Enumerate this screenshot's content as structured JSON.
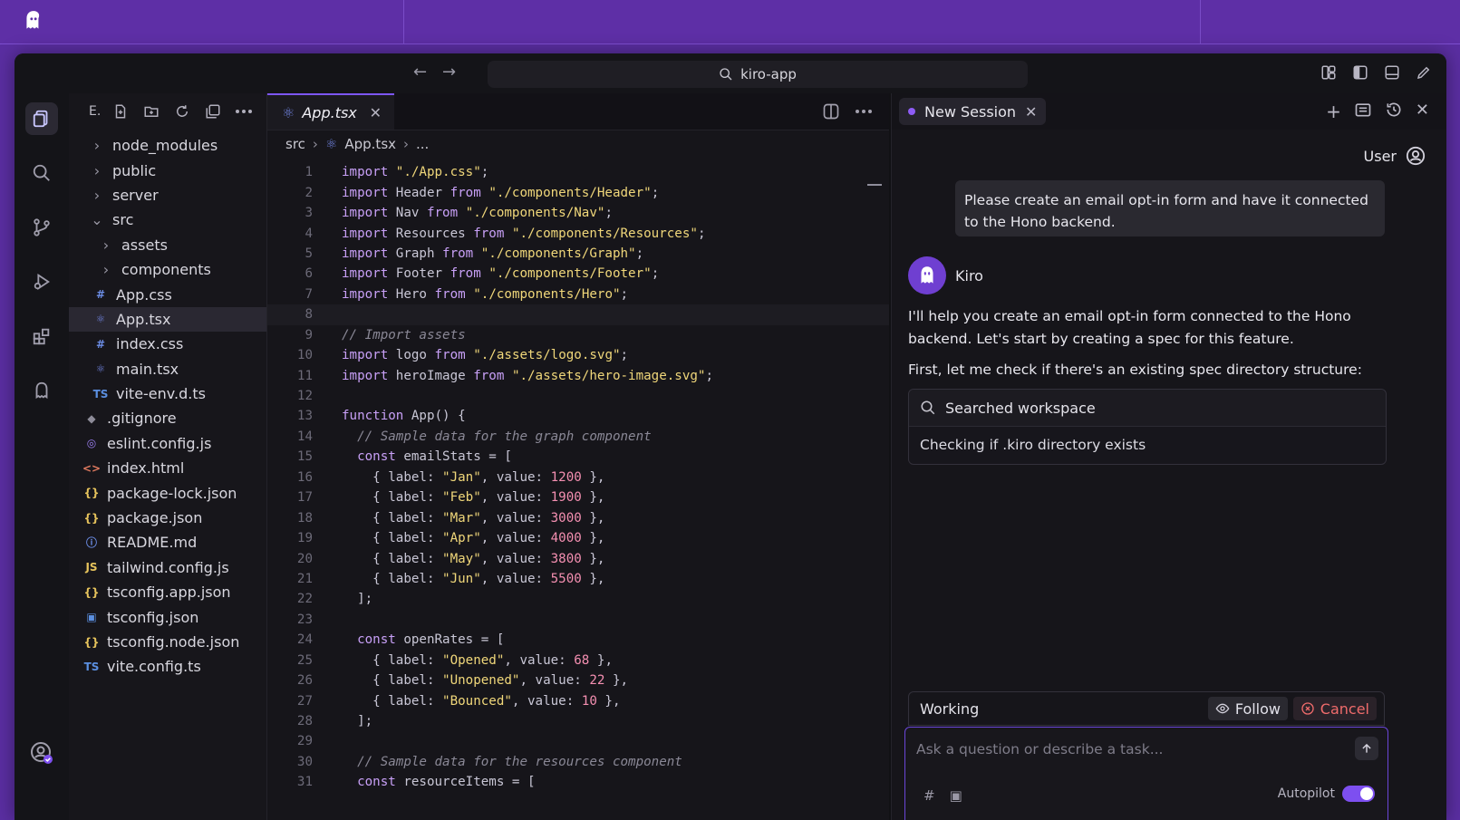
{
  "titlebar": {
    "search_text": "kiro-app"
  },
  "explorer": {
    "header_label": "E.",
    "items": [
      {
        "label": "node_modules",
        "type": "folder",
        "depth": 1,
        "expanded": false
      },
      {
        "label": "public",
        "type": "folder",
        "depth": 1,
        "expanded": false
      },
      {
        "label": "server",
        "type": "folder",
        "depth": 1,
        "expanded": false
      },
      {
        "label": "src",
        "type": "folder",
        "depth": 1,
        "expanded": true
      },
      {
        "label": "assets",
        "type": "folder",
        "depth": 2,
        "expanded": false
      },
      {
        "label": "components",
        "type": "folder",
        "depth": 2,
        "expanded": false
      },
      {
        "label": "App.css",
        "type": "css",
        "depth": 2
      },
      {
        "label": "App.tsx",
        "type": "tsx",
        "depth": 2,
        "selected": true
      },
      {
        "label": "index.css",
        "type": "css",
        "depth": 2
      },
      {
        "label": "main.tsx",
        "type": "tsx",
        "depth": 2
      },
      {
        "label": "vite-env.d.ts",
        "type": "ts",
        "depth": 2
      },
      {
        "label": ".gitignore",
        "type": "git",
        "depth": 1
      },
      {
        "label": "eslint.config.js",
        "type": "eslint",
        "depth": 1
      },
      {
        "label": "index.html",
        "type": "html",
        "depth": 1
      },
      {
        "label": "package-lock.json",
        "type": "json",
        "depth": 1
      },
      {
        "label": "package.json",
        "type": "json",
        "depth": 1
      },
      {
        "label": "README.md",
        "type": "info",
        "depth": 1
      },
      {
        "label": "tailwind.config.js",
        "type": "js",
        "depth": 1
      },
      {
        "label": "tsconfig.app.json",
        "type": "json",
        "depth": 1
      },
      {
        "label": "tsconfig.json",
        "type": "tsjson",
        "depth": 1
      },
      {
        "label": "tsconfig.node.json",
        "type": "json",
        "depth": 1
      },
      {
        "label": "vite.config.ts",
        "type": "ts",
        "depth": 1
      }
    ]
  },
  "editor": {
    "tab_label": "App.tsx",
    "breadcrumb": {
      "folder": "src",
      "file": "App.tsx",
      "more": "..."
    },
    "current_line": 8,
    "lines": [
      [
        [
          "kw",
          "import "
        ],
        [
          "str",
          "\"./App.css\""
        ],
        [
          "pn",
          ";"
        ]
      ],
      [
        [
          "kw",
          "import "
        ],
        [
          "id",
          "Header "
        ],
        [
          "kw",
          "from "
        ],
        [
          "str",
          "\"./components/Header\""
        ],
        [
          "pn",
          ";"
        ]
      ],
      [
        [
          "kw",
          "import "
        ],
        [
          "id",
          "Nav "
        ],
        [
          "kw",
          "from "
        ],
        [
          "str",
          "\"./components/Nav\""
        ],
        [
          "pn",
          ";"
        ]
      ],
      [
        [
          "kw",
          "import "
        ],
        [
          "id",
          "Resources "
        ],
        [
          "kw",
          "from "
        ],
        [
          "str",
          "\"./components/Resources\""
        ],
        [
          "pn",
          ";"
        ]
      ],
      [
        [
          "kw",
          "import "
        ],
        [
          "id",
          "Graph "
        ],
        [
          "kw",
          "from "
        ],
        [
          "str",
          "\"./components/Graph\""
        ],
        [
          "pn",
          ";"
        ]
      ],
      [
        [
          "kw",
          "import "
        ],
        [
          "id",
          "Footer "
        ],
        [
          "kw",
          "from "
        ],
        [
          "str",
          "\"./components/Footer\""
        ],
        [
          "pn",
          ";"
        ]
      ],
      [
        [
          "kw",
          "import "
        ],
        [
          "id",
          "Hero "
        ],
        [
          "kw",
          "from "
        ],
        [
          "str",
          "\"./components/Hero\""
        ],
        [
          "pn",
          ";"
        ]
      ],
      [],
      [
        [
          "cm",
          "// Import assets"
        ]
      ],
      [
        [
          "kw",
          "import "
        ],
        [
          "id",
          "logo "
        ],
        [
          "kw",
          "from "
        ],
        [
          "str",
          "\"./assets/logo.svg\""
        ],
        [
          "pn",
          ";"
        ]
      ],
      [
        [
          "kw",
          "import "
        ],
        [
          "id",
          "heroImage "
        ],
        [
          "kw",
          "from "
        ],
        [
          "str",
          "\"./assets/hero-image.svg\""
        ],
        [
          "pn",
          ";"
        ]
      ],
      [],
      [
        [
          "kw",
          "function "
        ],
        [
          "id",
          "App() {"
        ]
      ],
      [
        [
          "cm",
          "  // Sample data for the graph component"
        ]
      ],
      [
        [
          "kw",
          "  const "
        ],
        [
          "id",
          "emailStats = ["
        ]
      ],
      [
        [
          "pn",
          "    { label: "
        ],
        [
          "str",
          "\"Jan\""
        ],
        [
          "pn",
          ", value: "
        ],
        [
          "num",
          "1200"
        ],
        [
          "pn",
          " },"
        ]
      ],
      [
        [
          "pn",
          "    { label: "
        ],
        [
          "str",
          "\"Feb\""
        ],
        [
          "pn",
          ", value: "
        ],
        [
          "num",
          "1900"
        ],
        [
          "pn",
          " },"
        ]
      ],
      [
        [
          "pn",
          "    { label: "
        ],
        [
          "str",
          "\"Mar\""
        ],
        [
          "pn",
          ", value: "
        ],
        [
          "num",
          "3000"
        ],
        [
          "pn",
          " },"
        ]
      ],
      [
        [
          "pn",
          "    { label: "
        ],
        [
          "str",
          "\"Apr\""
        ],
        [
          "pn",
          ", value: "
        ],
        [
          "num",
          "4000"
        ],
        [
          "pn",
          " },"
        ]
      ],
      [
        [
          "pn",
          "    { label: "
        ],
        [
          "str",
          "\"May\""
        ],
        [
          "pn",
          ", value: "
        ],
        [
          "num",
          "3800"
        ],
        [
          "pn",
          " },"
        ]
      ],
      [
        [
          "pn",
          "    { label: "
        ],
        [
          "str",
          "\"Jun\""
        ],
        [
          "pn",
          ", value: "
        ],
        [
          "num",
          "5500"
        ],
        [
          "pn",
          " },"
        ]
      ],
      [
        [
          "pn",
          "  ];"
        ]
      ],
      [],
      [
        [
          "kw",
          "  const "
        ],
        [
          "id",
          "openRates = ["
        ]
      ],
      [
        [
          "pn",
          "    { label: "
        ],
        [
          "str",
          "\"Opened\""
        ],
        [
          "pn",
          ", value: "
        ],
        [
          "num",
          "68"
        ],
        [
          "pn",
          " },"
        ]
      ],
      [
        [
          "pn",
          "    { label: "
        ],
        [
          "str",
          "\"Unopened\""
        ],
        [
          "pn",
          ", value: "
        ],
        [
          "num",
          "22"
        ],
        [
          "pn",
          " },"
        ]
      ],
      [
        [
          "pn",
          "    { label: "
        ],
        [
          "str",
          "\"Bounced\""
        ],
        [
          "pn",
          ", value: "
        ],
        [
          "num",
          "10"
        ],
        [
          "pn",
          " },"
        ]
      ],
      [
        [
          "pn",
          "  ];"
        ]
      ],
      [],
      [
        [
          "cm",
          "  // Sample data for the resources component"
        ]
      ],
      [
        [
          "kw",
          "  const "
        ],
        [
          "id",
          "resourceItems = ["
        ]
      ]
    ]
  },
  "chat": {
    "session_tab": "New Session",
    "user_label": "User",
    "user_message": "Please create an email opt-in form and have it connected to the Hono backend.",
    "agent_name": "Kiro",
    "agent_message": "I'll help you create an email opt-in form connected to the Hono backend. Let's start by creating a spec for this feature.",
    "agent_message2": "First, let me check if there's an existing spec directory structure:",
    "tool_title": "Searched workspace",
    "tool_detail": "Checking if .kiro directory exists",
    "status": "Working",
    "follow_label": "Follow",
    "cancel_label": "Cancel",
    "input_placeholder": "Ask a question or describe a task...",
    "autopilot_label": "Autopilot"
  },
  "colors": {
    "accent": "#7d56f5",
    "frame_purple": "#5a2ea1",
    "keyword": "#c8a0f7",
    "string": "#f0d77a",
    "number": "#f48fb1"
  }
}
